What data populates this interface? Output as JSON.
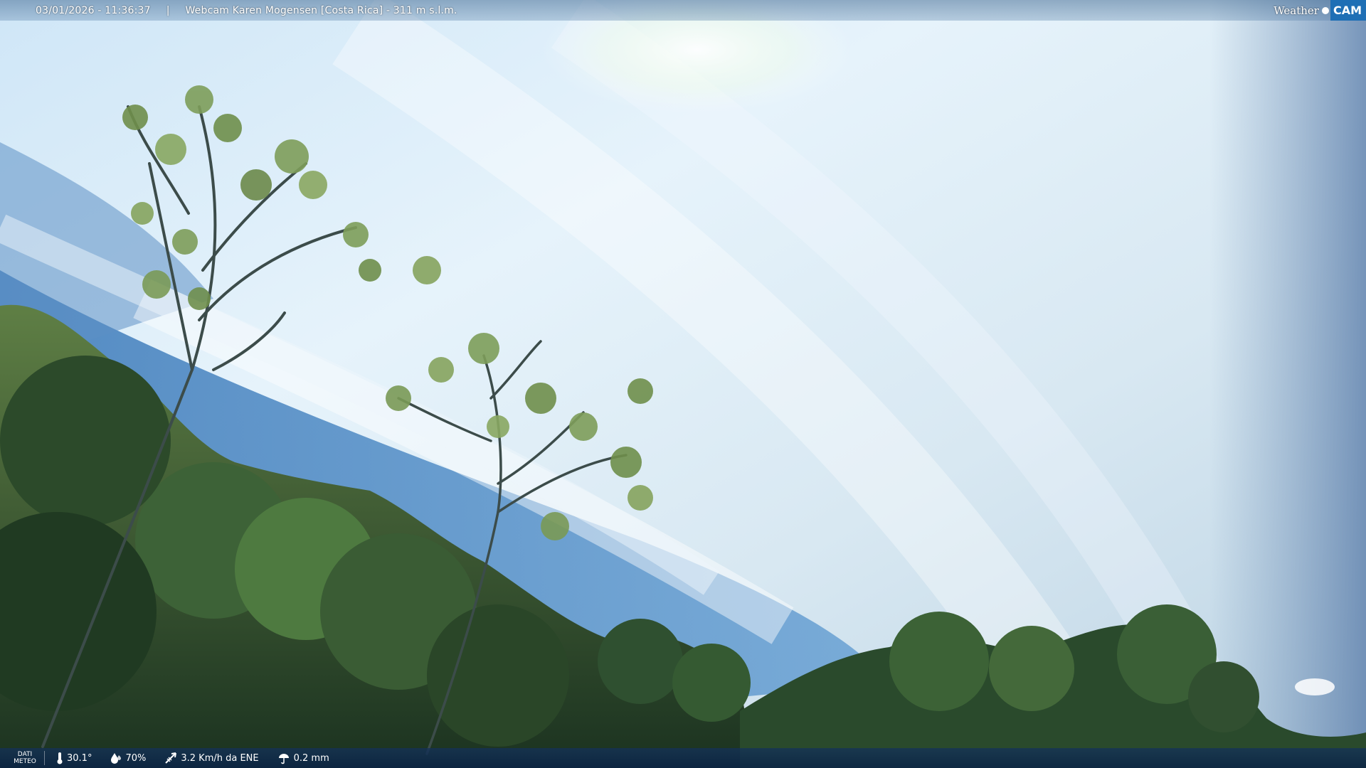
{
  "header": {
    "datetime": "03/01/2026 - 11:36:37",
    "separator": "|",
    "camera_name": "Webcam Karen Mogensen [Costa Rica] - 311 m s.l.m."
  },
  "logo": {
    "weather_text": "Weather",
    "cam_text": "CAM"
  },
  "footer": {
    "label_line1": "DATI",
    "label_line2": "METEO",
    "temperature": "30.1°",
    "humidity": "70%",
    "wind": "3.2 Km/h da ENE",
    "rain": "0.2 mm"
  },
  "icons": {
    "temperature": "thermometer-icon",
    "humidity": "humidity-drop-icon",
    "wind": "wind-icon",
    "rain": "rain-icon"
  },
  "colors": {
    "sky_top": "#dcefff",
    "sky_blue": "#3f7fc0",
    "foliage_dark": "#1f3a24",
    "foliage_light": "#8aa858",
    "logo_blue": "#1f6fb5"
  }
}
